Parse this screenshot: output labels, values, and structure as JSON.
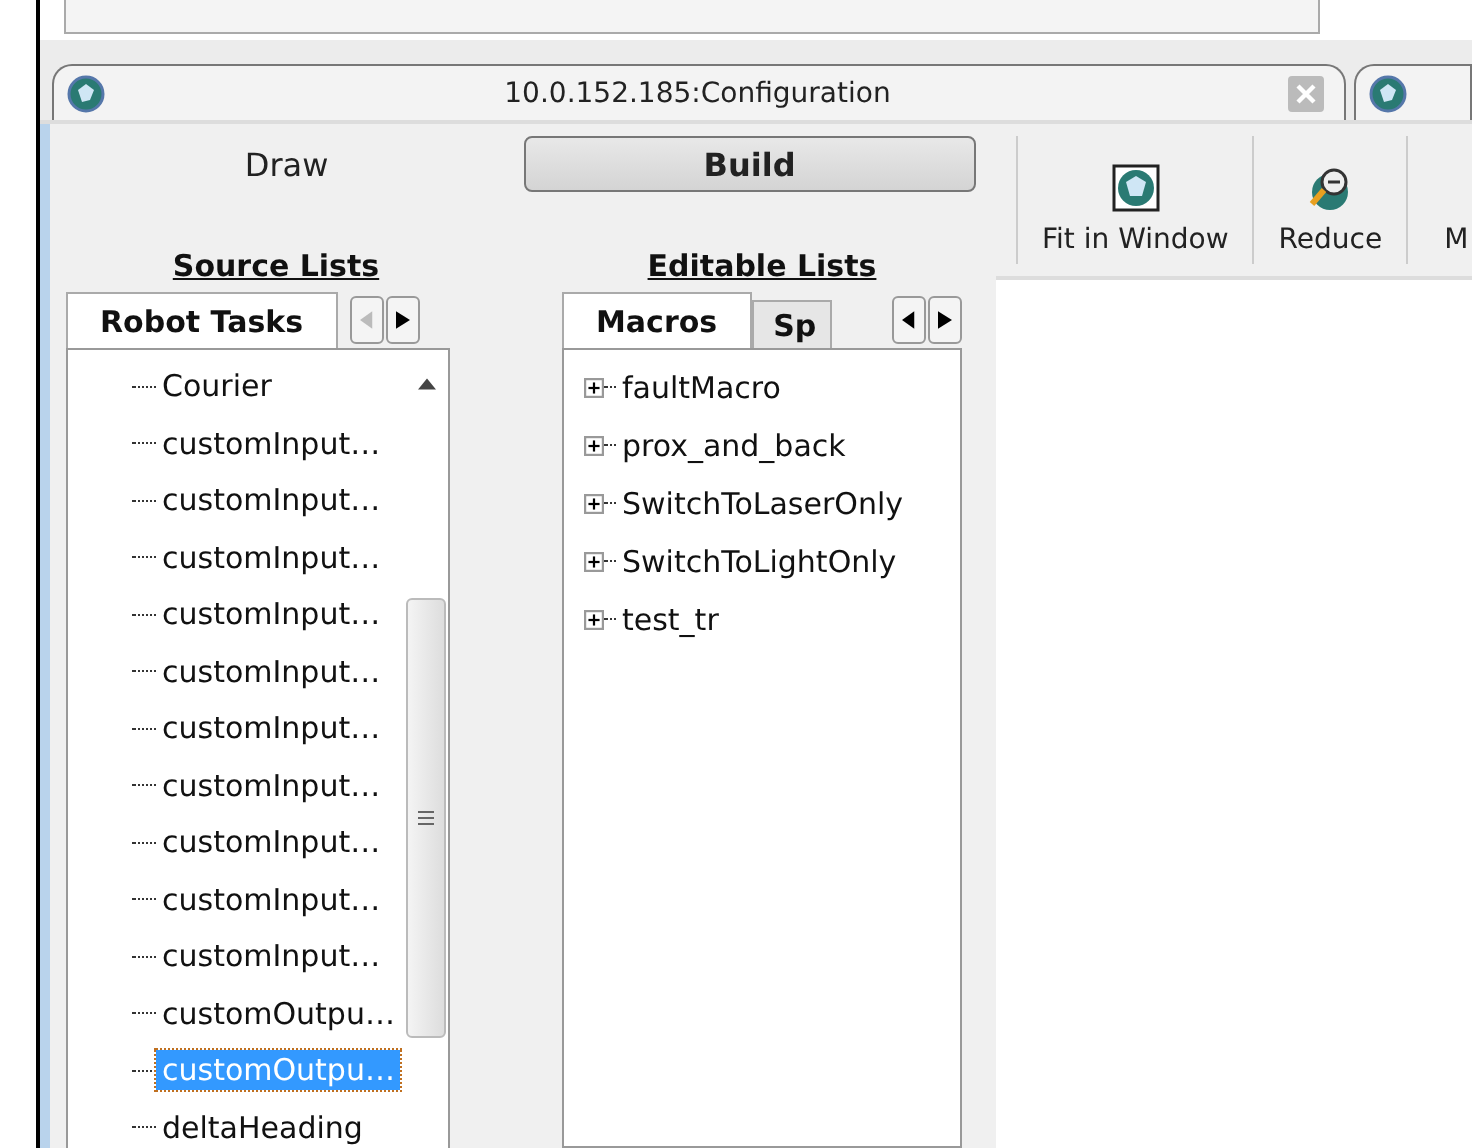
{
  "document_tab": {
    "title": "10.0.152.185:Configuration"
  },
  "modes": [
    {
      "label": "Draw",
      "selected": false
    },
    {
      "label": "Build",
      "selected": true
    }
  ],
  "source_lists": {
    "heading": "Source Lists",
    "tabs": [
      {
        "label": "Robot Tasks",
        "selected": true
      }
    ],
    "items": [
      {
        "label": "Courier",
        "selected": false
      },
      {
        "label": "customInput…",
        "selected": false
      },
      {
        "label": "customInput…",
        "selected": false
      },
      {
        "label": "customInput…",
        "selected": false
      },
      {
        "label": "customInput…",
        "selected": false
      },
      {
        "label": "customInput…",
        "selected": false
      },
      {
        "label": "customInput…",
        "selected": false
      },
      {
        "label": "customInput…",
        "selected": false
      },
      {
        "label": "customInput…",
        "selected": false
      },
      {
        "label": "customInput…",
        "selected": false
      },
      {
        "label": "customInput…",
        "selected": false
      },
      {
        "label": "customOutpu…",
        "selected": false
      },
      {
        "label": "customOutpu…",
        "selected": true
      },
      {
        "label": "deltaHeading",
        "selected": false
      }
    ]
  },
  "editable_lists": {
    "heading": "Editable Lists",
    "tabs": [
      {
        "label": "Macros",
        "selected": true
      },
      {
        "label": "Sp",
        "selected": false
      }
    ],
    "items": [
      {
        "label": "faultMacro",
        "expanded": false
      },
      {
        "label": "prox_and_back",
        "expanded": false
      },
      {
        "label": "SwitchToLaserOnly",
        "expanded": false
      },
      {
        "label": "SwitchToLightOnly",
        "expanded": false
      },
      {
        "label": "test_tr",
        "expanded": false
      }
    ]
  },
  "toolbar": [
    {
      "label": "Fit in Window",
      "kind": "fit"
    },
    {
      "label": "Reduce",
      "kind": "reduce"
    },
    {
      "label": "M",
      "kind": "cut"
    }
  ]
}
